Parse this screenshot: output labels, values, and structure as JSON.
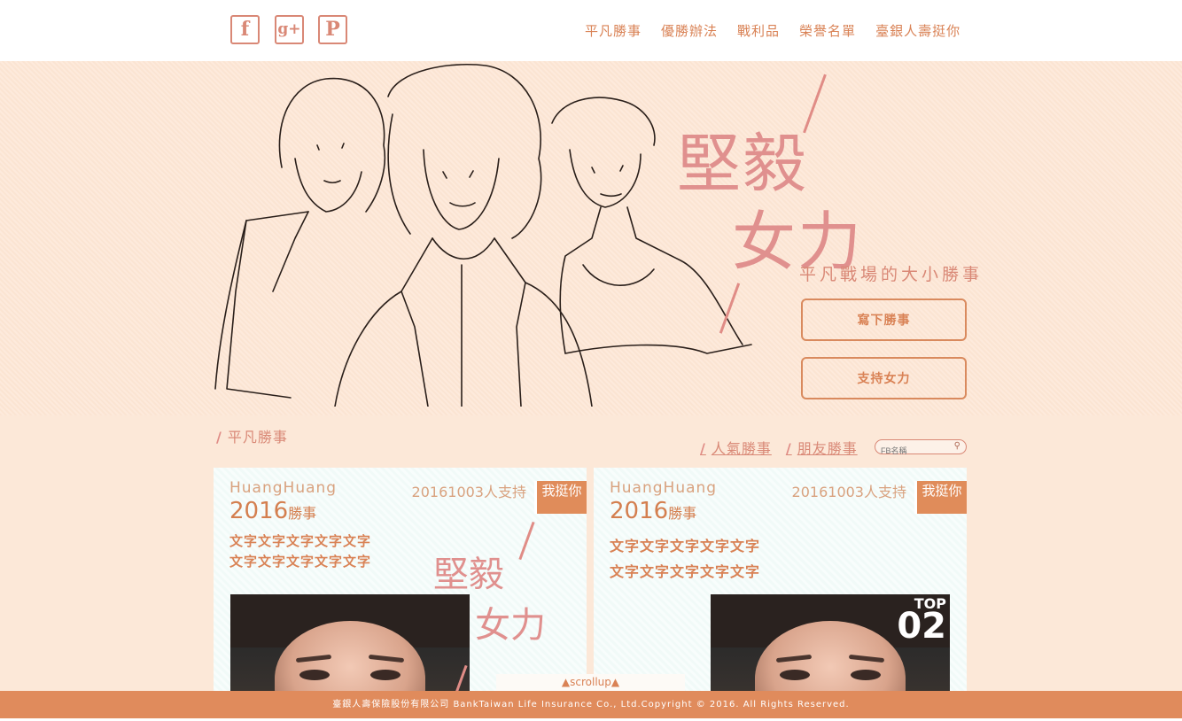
{
  "header": {
    "social": [
      {
        "icon": "facebook-icon",
        "glyph": "f"
      },
      {
        "icon": "google-plus-icon",
        "glyph": "g+"
      },
      {
        "icon": "pinterest-icon",
        "glyph": "P"
      }
    ],
    "nav": [
      "平凡勝事",
      "優勝辦法",
      "戰利品",
      "榮譽名單",
      "臺銀人壽挺你"
    ]
  },
  "hero": {
    "slogan_line1": "堅毅",
    "slogan_line2": "女力",
    "subtitle": "平凡戰場的大小勝事",
    "btn_write": "寫下勝事",
    "btn_support": "支持女力"
  },
  "section": {
    "title": "平凡勝事",
    "filter_popular": "人氣勝事",
    "filter_friends": "朋友勝事",
    "search_placeholder": "FB名稱"
  },
  "cards": [
    {
      "user": "HuangHuang",
      "support": "20161003人支持",
      "cheer": "我挺你",
      "year": "2016",
      "year_suffix": "勝事",
      "line1": "文字文字文字文字文字",
      "line2": "文字文字文字文字文字",
      "overlay_line1": "堅毅",
      "overlay_line2": "女力"
    },
    {
      "user": "HuangHuang",
      "support": "20161003人支持",
      "cheer": "我挺你",
      "year": "2016",
      "year_suffix": "勝事",
      "line1": "文字文字文字文字文字",
      "line2": "文字文字文字文字文字",
      "badge_top": "TOP",
      "badge_rank": "02"
    }
  ],
  "scrollup": "▲scrollup▲",
  "footer": "臺銀人壽保險股份有限公司  BankTaiwan Life Insurance Co., Ltd.Copyright © 2016. All Rights Reserved.",
  "colors": {
    "accent": "#e08b5c",
    "pink": "#e0908e",
    "bg": "#fce8d8"
  }
}
